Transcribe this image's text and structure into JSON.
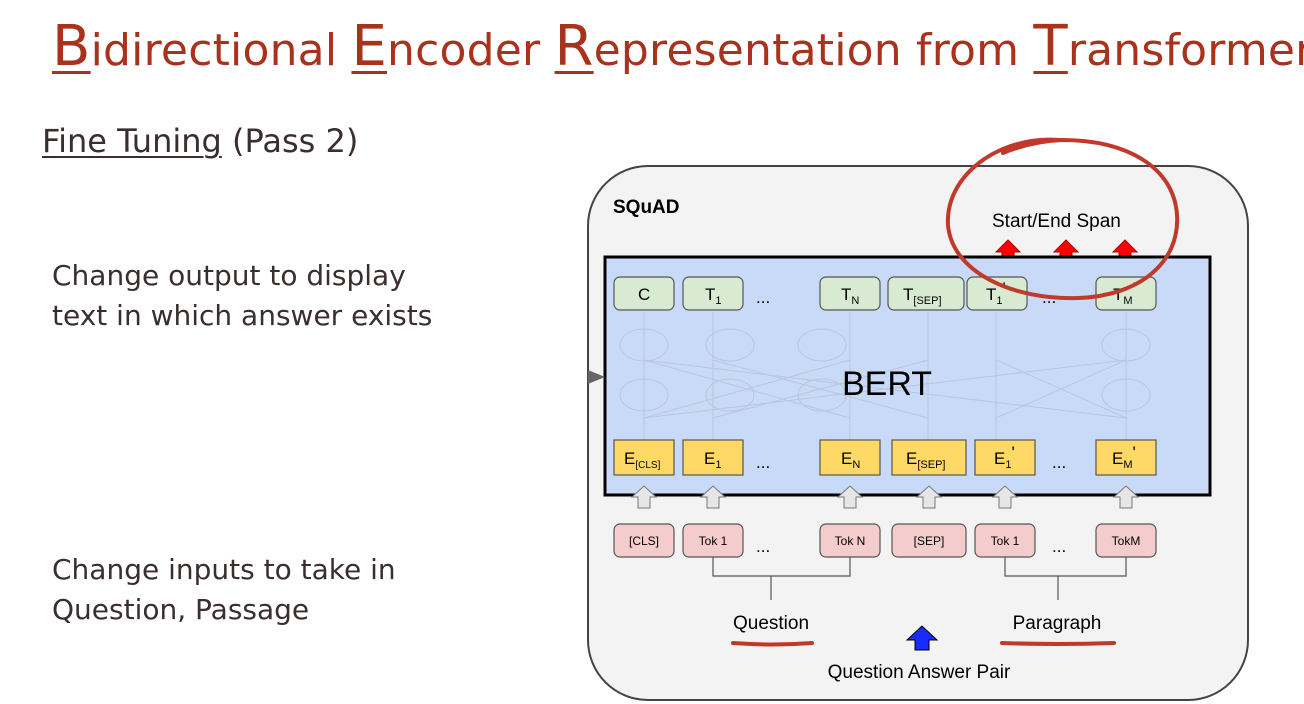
{
  "title": {
    "parts": [
      {
        "cap": "B",
        "rest": "idirectional "
      },
      {
        "cap": "E",
        "rest": "ncoder "
      },
      {
        "cap": "R",
        "rest": "epresentation from "
      },
      {
        "cap": "T",
        "rest": "ransformers"
      }
    ]
  },
  "subtitle": {
    "underlined": "Fine Tuning",
    "rest": " (Pass 2)"
  },
  "bullets": {
    "output": {
      "line1": "Change output to display",
      "line2": "text in which answer exists"
    },
    "inputs": {
      "line1": "Change inputs to take in",
      "line2": "Question, Passage"
    }
  },
  "diagram": {
    "task_label": "SQuAD",
    "output_label": "Start/End Span",
    "model_label": "BERT",
    "ellipsis": "...",
    "output_tokens": {
      "c": "C",
      "t1": "T",
      "t1_sub": "1",
      "tn": "T",
      "tn_sub": "N",
      "tsep": "T",
      "tsep_sub": "[SEP]",
      "t1p": "T",
      "t1p_sub": "1",
      "t1p_prime": "'",
      "tm": "T",
      "tm_sub": "M",
      "tm_prime": "'"
    },
    "embeddings": {
      "ecls": "E",
      "ecls_sub": "[CLS]",
      "e1": "E",
      "e1_sub": "1",
      "en": "E",
      "en_sub": "N",
      "esep": "E",
      "esep_sub": "[SEP]",
      "e1p": "E",
      "e1p_sub": "1",
      "e1p_prime": "'",
      "em": "E",
      "em_sub": "M",
      "em_prime": "'"
    },
    "input_tokens": {
      "cls": "[CLS]",
      "tok1": "Tok 1",
      "tokn": "Tok N",
      "sep": "[SEP]",
      "tok1b": "Tok 1",
      "tokm": "TokM"
    },
    "question_label": "Question",
    "paragraph_label": "Paragraph",
    "pair_label": "Question Answer Pair"
  },
  "colors": {
    "title": "#a8321c",
    "text": "#3a2e2e",
    "bert_bg": "#c9daf8",
    "out_token": "#d9ead3",
    "embed": "#ffd966",
    "input": "#f4cccc",
    "red_arrow": "#ff0000",
    "blue_arrow": "#1a2bff",
    "annotation": "#c0392b"
  }
}
